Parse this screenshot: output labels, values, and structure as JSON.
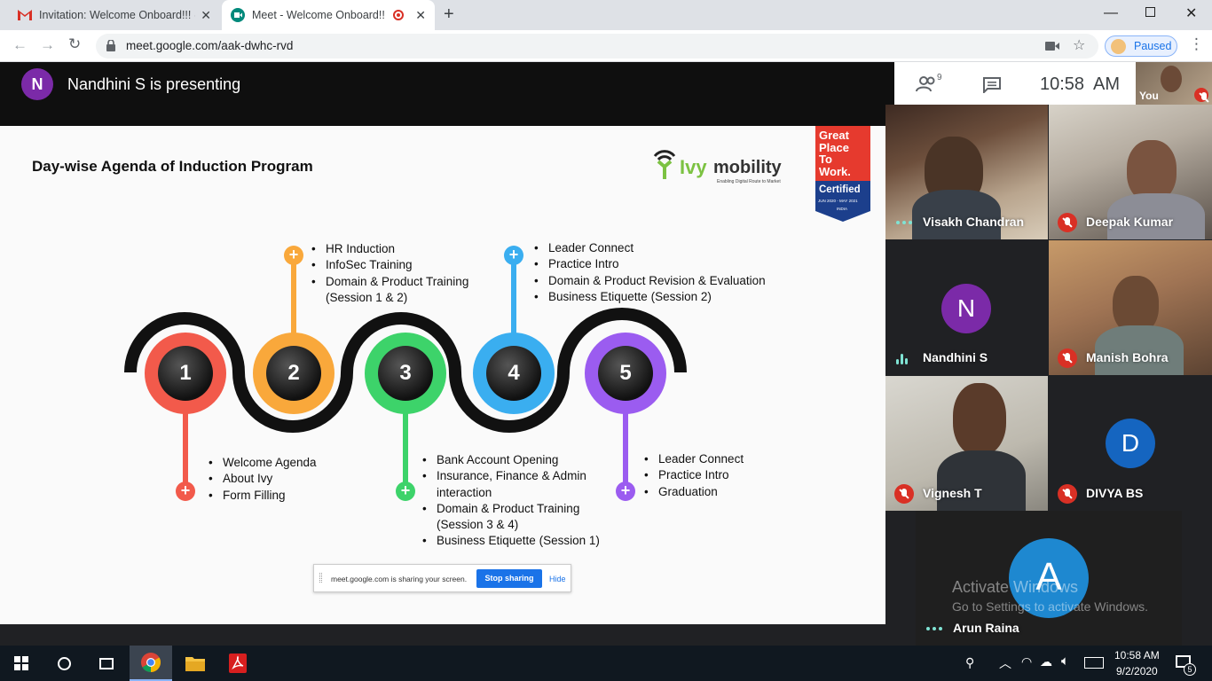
{
  "browser": {
    "tabs": [
      {
        "title": "Invitation: Welcome Onboard!!! @"
      },
      {
        "title": "Meet - Welcome Onboard!!!"
      }
    ],
    "url": "meet.google.com/aak-dwhc-rvd",
    "profile_status": "Paused"
  },
  "meet": {
    "presenter_initial": "N",
    "presenter_banner": "Nandhini S is presenting",
    "people_count": "9",
    "time": "10:58  AM",
    "self_label": "You",
    "participants": [
      {
        "name": "Visakh Chandran",
        "status": "talking"
      },
      {
        "name": "Deepak Kumar",
        "status": "muted"
      },
      {
        "name": "Nandhini S",
        "initial": "N",
        "status": "speaking"
      },
      {
        "name": "Manish Bohra",
        "status": "muted"
      },
      {
        "name": "Vignesh T",
        "status": "muted"
      },
      {
        "name": "DIVYA BS",
        "initial": "D",
        "status": "muted"
      },
      {
        "name": "Arun Raina",
        "initial": "A",
        "status": "talking"
      }
    ]
  },
  "slide": {
    "title": "Day-wise Agenda of Induction Program",
    "logo_text_ivy": "Ivy",
    "logo_text_mobility": "mobility",
    "logo_tagline": "Enabling Digital Route to Market",
    "gptw": {
      "line1": "Great",
      "line2": "Place",
      "line3": "To",
      "line4": "Work.",
      "certified": "Certified",
      "period": "JUN 2020 - MAY 2021",
      "country": "INDIA"
    },
    "steps": [
      {
        "num": "1",
        "color": "#f25a4b",
        "items": [
          "Welcome Agenda",
          "About Ivy",
          "Form Filling"
        ]
      },
      {
        "num": "2",
        "color": "#f9a83b",
        "items": [
          "HR Induction",
          "InfoSec Training",
          "Domain & Product Training (Session 1 & 2)"
        ]
      },
      {
        "num": "3",
        "color": "#3dd36a",
        "items": [
          "Bank Account Opening",
          "Insurance, Finance & Admin interaction",
          "Domain & Product Training (Session 3 & 4)",
          "Business Etiquette (Session 1)"
        ]
      },
      {
        "num": "4",
        "color": "#3aaef0",
        "items": [
          "Leader Connect",
          "Practice Intro",
          "Domain & Product Revision & Evaluation",
          "Business Etiquette (Session 2)"
        ]
      },
      {
        "num": "5",
        "color": "#9b5cf0",
        "items": [
          "Leader Connect",
          "Practice Intro",
          "Graduation"
        ]
      }
    ]
  },
  "share_banner": {
    "text": "meet.google.com is sharing your screen.",
    "stop": "Stop sharing",
    "hide": "Hide"
  },
  "watermark": {
    "line1": "Activate Windows",
    "line2": "Go to Settings to activate Windows."
  },
  "taskbar": {
    "time": "10:58 AM",
    "date": "9/2/2020",
    "notifications": "5"
  }
}
